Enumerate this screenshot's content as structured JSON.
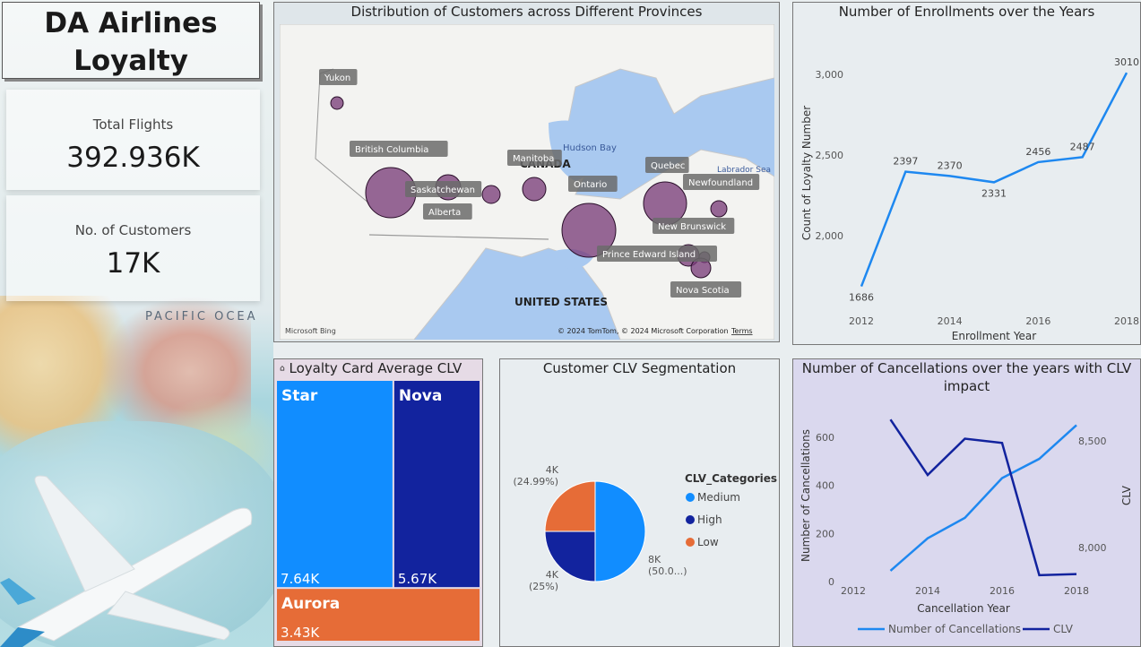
{
  "title": {
    "line1": "DA Airlines",
    "line2": "Loyalty"
  },
  "kpis": {
    "total_flights_label": "Total Flights",
    "total_flights_value": "392.936K",
    "customers_label": "No. of Customers",
    "customers_value": "17K"
  },
  "background": {
    "ocean_label": "PACIFIC OCEA"
  },
  "map": {
    "title": "Distribution of Customers across Different Provinces",
    "place_labels": [
      "CANADA",
      "UNITED STATES",
      "Hudson Bay",
      "Labrador Sea"
    ],
    "provinces": [
      "Yukon",
      "British Columbia",
      "Saskatchewan",
      "Alberta",
      "Manitoba",
      "Ontario",
      "Quebec",
      "Newfoundland",
      "New Brunswick",
      "Prince Edward Island",
      "Nova Scotia"
    ],
    "bing": "Microsoft Bing",
    "copyright": "© 2024 TomTom, © 2024 Microsoft Corporation",
    "terms": "Terms",
    "bubble_color": "#7a3d7a"
  },
  "charts": {
    "enrollments_title": "Number of Enrollments over the Years",
    "treemap_title": "Loyalty Card Average CLV",
    "pie_title": "Customer CLV Segmentation",
    "cancel_title_line1": "Number of Cancellations over the years with CLV",
    "cancel_title_line2": "impact"
  },
  "chart_data": [
    {
      "type": "line",
      "title": "Number of Enrollments over the Years",
      "xlabel": "Enrollment Year",
      "ylabel": "Count of Loyalty Number",
      "x": [
        2012,
        2013,
        2014,
        2015,
        2016,
        2017,
        2018
      ],
      "x_ticks": [
        "2012",
        "2014",
        "2016",
        "2018"
      ],
      "y_ticks": [
        "2,000",
        "2,500",
        "3,000"
      ],
      "ylim": [
        1600,
        3100
      ],
      "series": [
        {
          "values": [
            1686,
            2397,
            2370,
            2331,
            2456,
            2487,
            3010
          ],
          "color": "#1e88f0"
        }
      ],
      "data_labels": [
        "1686",
        "2397",
        "2370",
        "2331",
        "2456",
        "2487",
        "3010"
      ]
    },
    {
      "type": "treemap",
      "title": "Loyalty Card Average CLV",
      "items": [
        {
          "name": "Star",
          "label": "7.64K",
          "value": 7640,
          "color": "#118dff"
        },
        {
          "name": "Nova",
          "label": "5.67K",
          "value": 5670,
          "color": "#12239e"
        },
        {
          "name": "Aurora",
          "label": "3.43K",
          "value": 3430,
          "color": "#e66c37"
        }
      ]
    },
    {
      "type": "pie",
      "title": "Customer CLV Segmentation",
      "legend_title": "CLV_Categories",
      "legend_position": "right",
      "slices": [
        {
          "name": "Medium",
          "value": 8,
          "percent": 50.0,
          "label": "8K",
          "pct_label": "(50.0...)",
          "color": "#118dff"
        },
        {
          "name": "High",
          "value": 4,
          "percent": 25,
          "label": "4K",
          "pct_label": "(25%)",
          "color": "#12239e"
        },
        {
          "name": "Low",
          "value": 4,
          "percent": 24.99,
          "label": "4K",
          "pct_label": "(24.99%)",
          "color": "#e66c37"
        }
      ]
    },
    {
      "type": "line",
      "title": "Number of Cancellations over the years with CLV impact",
      "xlabel": "Cancellation Year",
      "ylabel": "Number of Cancellations",
      "ylabel_right": "CLV",
      "x": [
        2013,
        2014,
        2015,
        2016,
        2017,
        2018
      ],
      "x_ticks": [
        "2012",
        "2014",
        "2016",
        "2018"
      ],
      "xlim": [
        2012,
        2018
      ],
      "y_ticks": [
        "0",
        "200",
        "400",
        "600"
      ],
      "ylim": [
        0,
        700
      ],
      "y2_ticks": [
        "8,000",
        "8,500"
      ],
      "y2lim": [
        7840,
        8630
      ],
      "legend_position": "bottom",
      "series": [
        {
          "name": "Number of Cancellations",
          "axis": "left",
          "values": [
            45,
            180,
            265,
            430,
            510,
            650
          ],
          "color": "#1e88f0"
        },
        {
          "name": "CLV",
          "axis": "right",
          "values": [
            8600,
            8340,
            8510,
            8490,
            7870,
            7875
          ],
          "color": "#12239e"
        }
      ]
    }
  ]
}
